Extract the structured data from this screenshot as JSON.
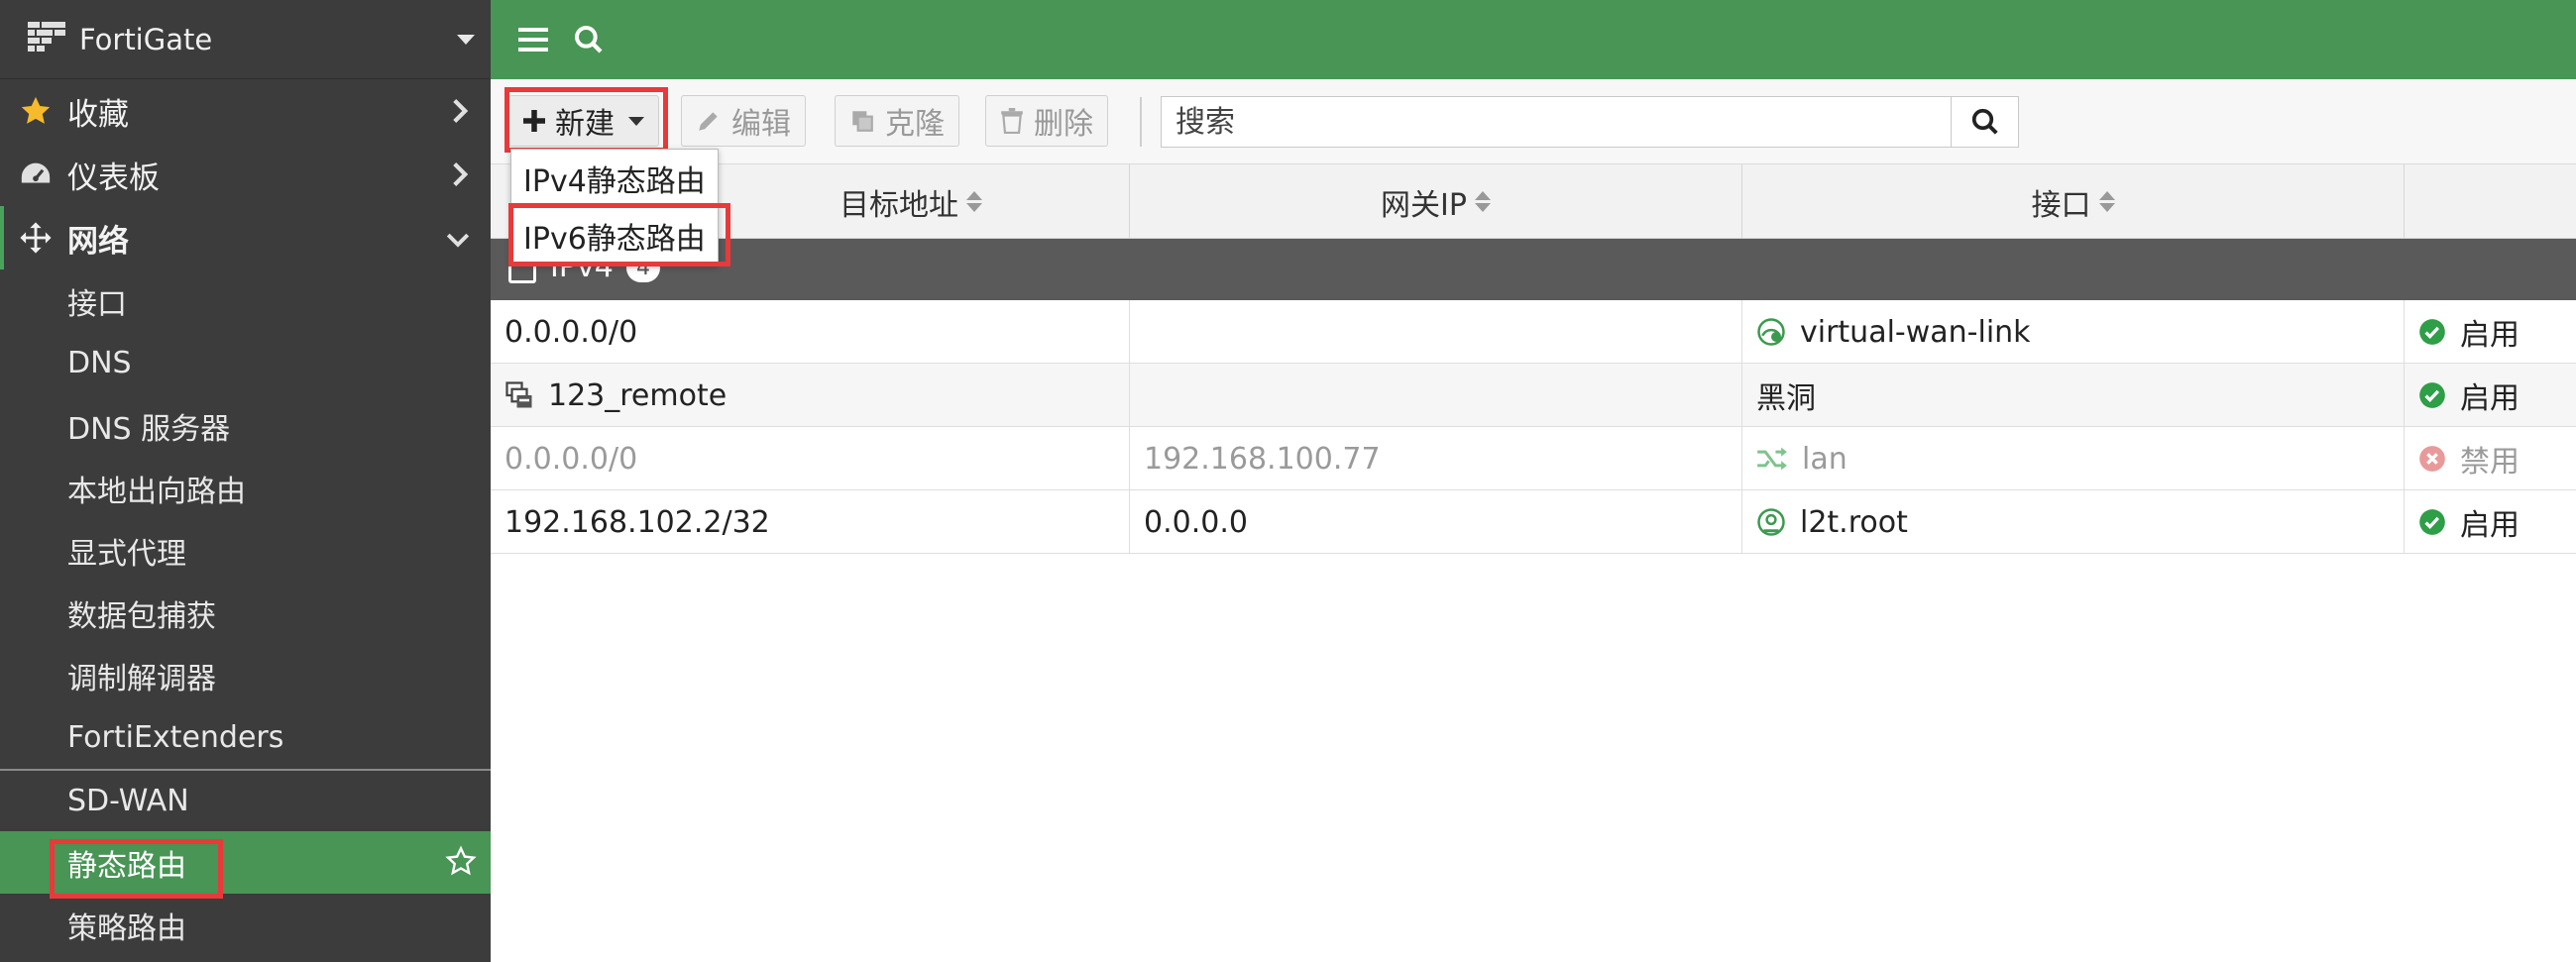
{
  "app": {
    "brand": "FortiGate"
  },
  "sidebar": {
    "favorites": "收藏",
    "dashboard": "仪表板",
    "network": "网络",
    "items": [
      "接口",
      "DNS",
      "DNS 服务器",
      "本地出向路由",
      "显式代理",
      "数据包捕获",
      "调制解调器",
      "FortiExtenders",
      "SD-WAN",
      "静态路由",
      "策略路由"
    ],
    "selected_index": 9
  },
  "toolbar": {
    "new_label": "新建",
    "edit_label": "编辑",
    "clone_label": "克隆",
    "delete_label": "删除",
    "search_placeholder": "搜索"
  },
  "new_menu": {
    "ipv4": "IPv4静态路由",
    "ipv6": "IPv6静态路由"
  },
  "table": {
    "columns": {
      "destination_partial": "目标地址",
      "gateway": "网关IP",
      "interface": "接口"
    },
    "group": {
      "label": "IPv4",
      "count": "4"
    },
    "rows": [
      {
        "destination": "0.0.0.0/0",
        "gateway": "",
        "interface": "virtual-wan-link",
        "interface_icon": "sdwan-icon",
        "status": "启用",
        "status_icon": "check-icon"
      },
      {
        "destination": "123_remote",
        "dest_icon": "address-group-icon",
        "gateway": "",
        "interface": "黑洞",
        "status": "启用",
        "status_icon": "check-icon"
      },
      {
        "destination": "0.0.0.0/0",
        "gateway": "192.168.100.77",
        "interface": "lan",
        "interface_icon": "shuffle-icon",
        "status": "禁用",
        "status_icon": "disabled-icon",
        "row_state": "disabled"
      },
      {
        "destination": "192.168.102.2/32",
        "gateway": "0.0.0.0",
        "interface": "l2t.root",
        "interface_icon": "tunnel-icon",
        "status": "启用",
        "status_icon": "check-icon"
      }
    ]
  },
  "colors": {
    "accent_green": "#489555",
    "sidebar_bg": "#3c3c3c",
    "highlight_red": "#e8393b",
    "status_green": "#2e9e47",
    "status_red": "#e05a5a"
  }
}
